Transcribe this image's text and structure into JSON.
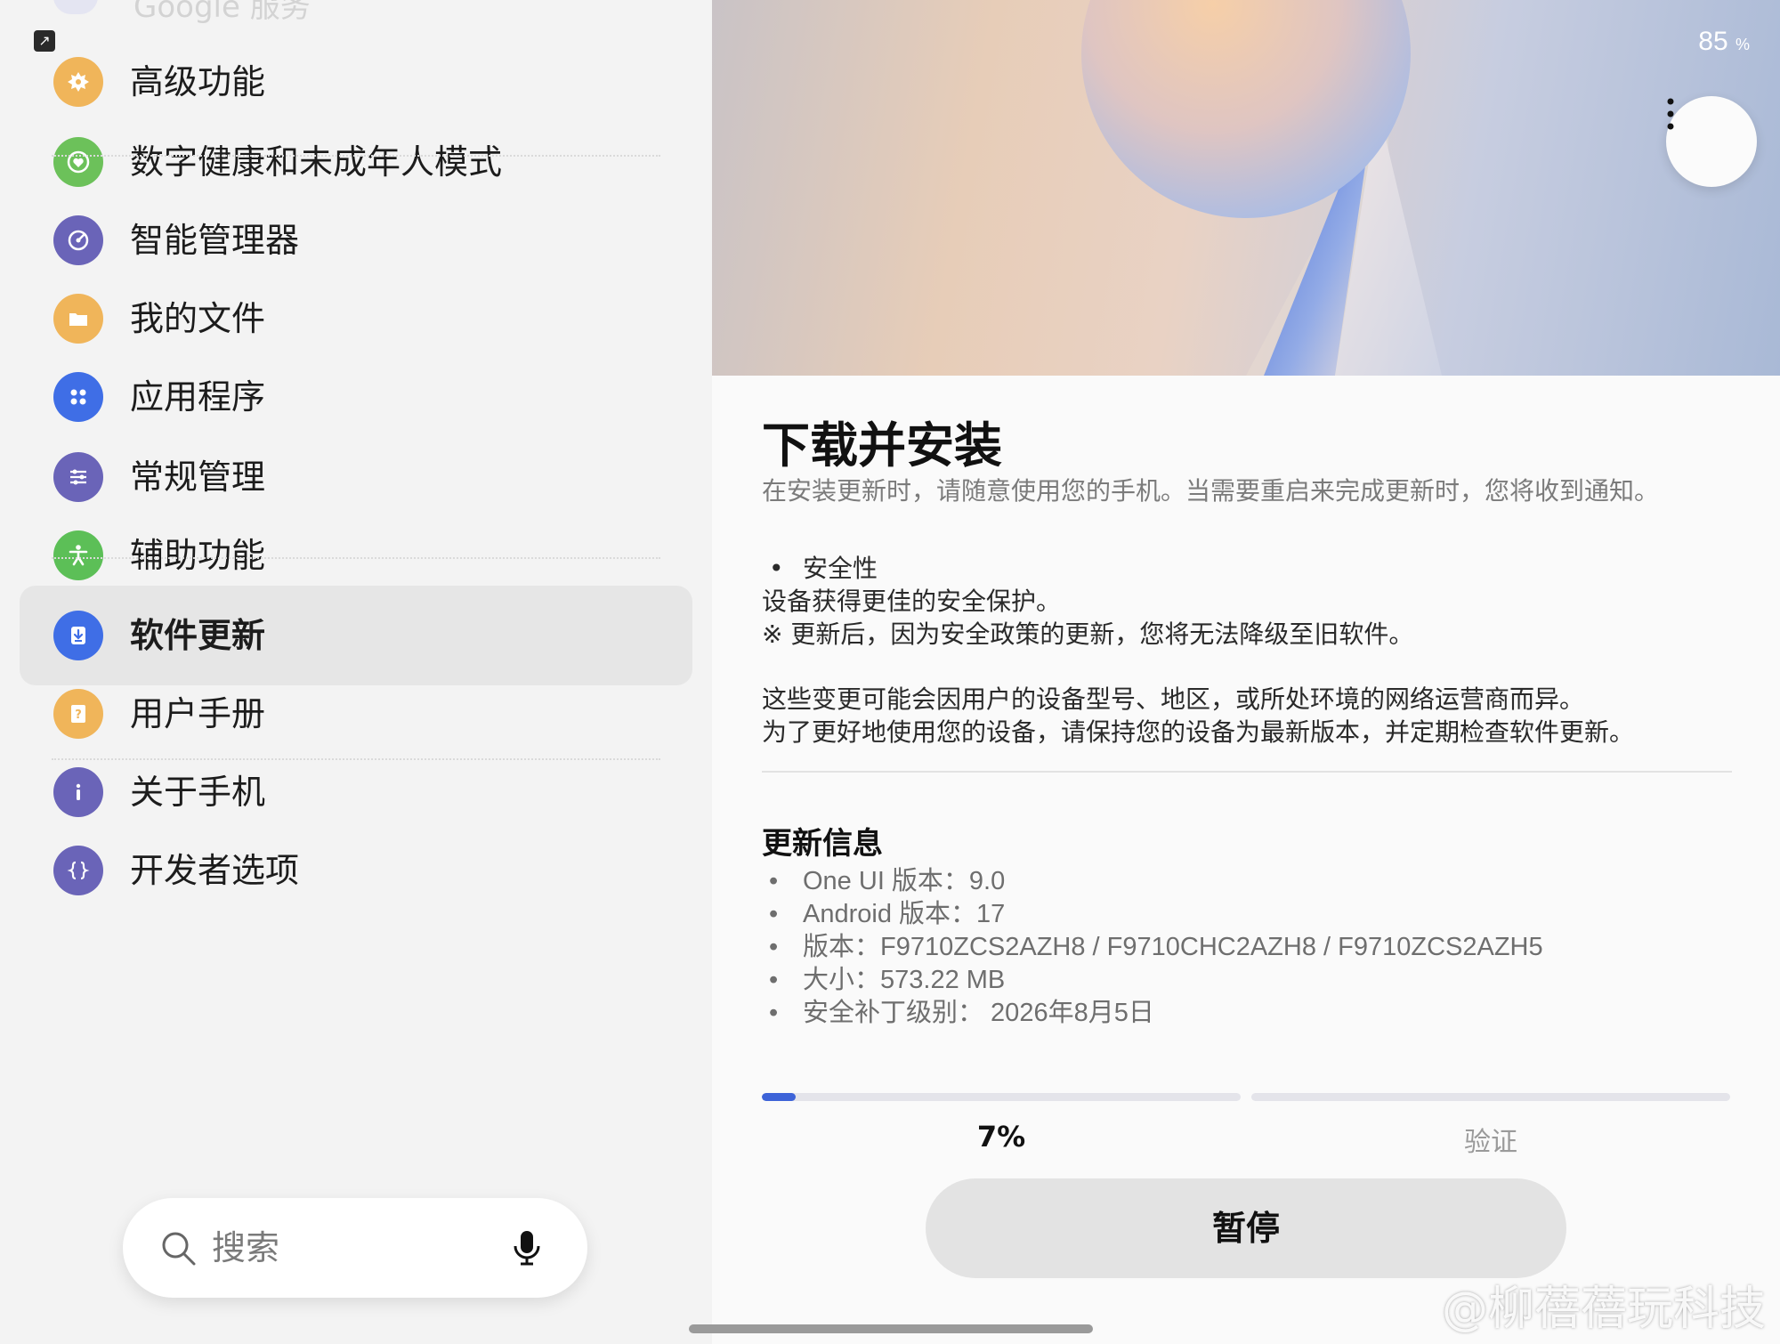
{
  "settings": {
    "ghost_label": "Google 服务",
    "items": [
      {
        "label": "高级功能",
        "icon": "advanced-features-icon",
        "color": "#f0b55a"
      },
      {
        "label": "数字健康和未成年人模式",
        "icon": "digital-wellbeing-icon",
        "color": "#6cc15a"
      },
      {
        "label": "智能管理器",
        "icon": "device-care-icon",
        "color": "#6a64b8"
      },
      {
        "label": "我的文件",
        "icon": "folder-icon",
        "color": "#f0b55a"
      },
      {
        "label": "应用程序",
        "icon": "apps-icon",
        "color": "#3f6ee6"
      },
      {
        "label": "常规管理",
        "icon": "general-management-icon",
        "color": "#6a64b8"
      },
      {
        "label": "辅助功能",
        "icon": "accessibility-icon",
        "color": "#5cbf57"
      },
      {
        "label": "软件更新",
        "icon": "software-update-icon",
        "color": "#3f6ee6",
        "active": true
      },
      {
        "label": "用户手册",
        "icon": "user-manual-icon",
        "color": "#f0b55a"
      },
      {
        "label": "关于手机",
        "icon": "info-icon",
        "color": "#6a64b8"
      },
      {
        "label": "开发者选项",
        "icon": "developer-options-icon",
        "color": "#6a64b8"
      }
    ],
    "search_placeholder": "搜索"
  },
  "status": {
    "battery": "85",
    "battery_unit": "%"
  },
  "update": {
    "title": "下载并安装",
    "subtitle": "在安装更新时，请随意使用您的手机。当需要重启来完成更新时，您将收到通知。",
    "bullet_security": "安全性",
    "security_line1": "设备获得更佳的安全保护。",
    "security_line2": "※ 更新后，因为安全政策的更新，您将无法降级至旧软件。",
    "note_line1": "这些变更可能会因用户的设备型号、地区，或所处环境的网络运营商而异。",
    "note_line2": "为了更好地使用您的设备，请保持您的设备为最新版本，并定期检查软件更新。",
    "info_title": "更新信息",
    "info": [
      "One UI 版本：9.0",
      "Android 版本：17",
      "版本：F9710ZCS2AZH8 / F9710CHC2AZH8 / F9710ZCS2AZH5",
      "大小：573.22 MB",
      "安全补丁级别： 2026年8月5日"
    ],
    "progress_percent": 7,
    "progress_label": "7%",
    "verify_label": "验证",
    "pause_label": "暂停"
  },
  "watermark": "@柳蓓蓓玩科技",
  "colors": {
    "accent": "#3d63d8"
  }
}
